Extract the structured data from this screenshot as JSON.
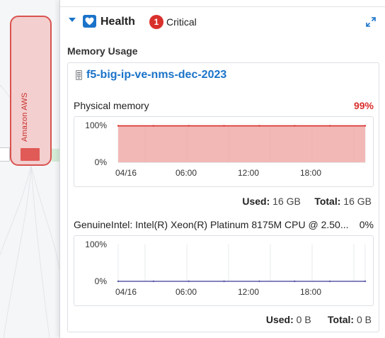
{
  "background": {
    "node_label": "Amazon AWS"
  },
  "panel": {
    "title": "Health",
    "title_icon": "heart-icon",
    "critical_count": "1",
    "critical_label": "Critical",
    "section_title": "Memory Usage",
    "host_name": "f5-big-ip-ve-nms-dec-2023",
    "host_icon": "server-icon"
  },
  "colors": {
    "accent": "#1a73c9",
    "critical": "#d9302c",
    "memory_fill": "#f2b8b6",
    "memory_line": "#d9302c",
    "cpu_line": "#5a5aa8"
  },
  "metrics": [
    {
      "label": "Physical memory",
      "value": "99%",
      "used_label": "Used:",
      "used_value": "16 GB",
      "total_label": "Total:",
      "total_value": "16 GB",
      "chart_data": {
        "type": "area",
        "x": [
          "04/16",
          "06:00",
          "12:00",
          "18:00"
        ],
        "y_ticks": [
          "100%",
          "0%"
        ],
        "ylim": [
          0,
          100
        ],
        "series": [
          {
            "values": [
              99,
              99,
              99,
              99,
              99,
              99,
              99,
              99
            ]
          }
        ]
      }
    },
    {
      "label": "GenuineIntel: Intel(R) Xeon(R) Platinum 8175M CPU @ 2.50...",
      "value": "0%",
      "used_label": "Used:",
      "used_value": "0 B",
      "total_label": "Total:",
      "total_value": "0 B",
      "chart_data": {
        "type": "line",
        "x": [
          "04/16",
          "06:00",
          "12:00",
          "18:00"
        ],
        "y_ticks": [
          "100%",
          "0%"
        ],
        "ylim": [
          0,
          100
        ],
        "series": [
          {
            "values": [
              0,
              0,
              0,
              0,
              0,
              0,
              0,
              0
            ]
          }
        ]
      }
    }
  ]
}
